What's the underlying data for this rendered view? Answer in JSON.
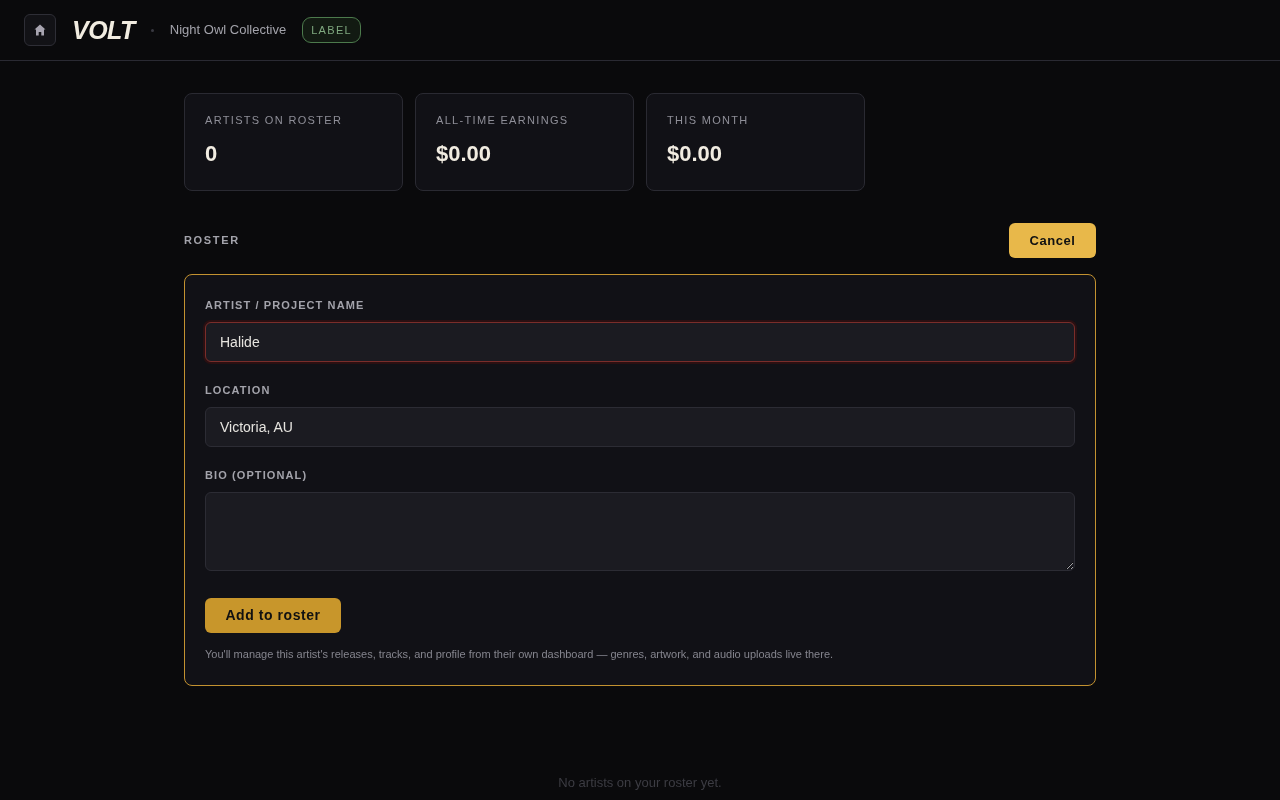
{
  "header": {
    "logo": "VOLT",
    "account_name": "Night Owl Collective",
    "badge": "LABEL"
  },
  "stats": [
    {
      "label": "ARTISTS ON ROSTER",
      "value": "0"
    },
    {
      "label": "ALL-TIME EARNINGS",
      "value": "$0.00"
    },
    {
      "label": "THIS MONTH",
      "value": "$0.00"
    }
  ],
  "section": {
    "title": "ROSTER",
    "action": "Cancel"
  },
  "form": {
    "fields": [
      {
        "kind": "input",
        "label": "ARTIST / PROJECT NAME",
        "value": "Halide",
        "focused": true
      },
      {
        "kind": "input",
        "label": "LOCATION",
        "value": "Victoria, AU",
        "focused": false
      },
      {
        "kind": "textarea",
        "label": "BIO (OPTIONAL)",
        "focused": false
      }
    ],
    "submit": "Add to roster",
    "note": "You'll manage this artist's releases, tracks, and profile from their own dashboard — genres, artwork, and audio uploads live there."
  },
  "empty_state": "No artists on your roster yet."
}
